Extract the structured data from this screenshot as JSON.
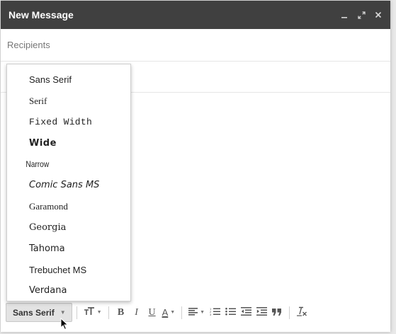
{
  "window": {
    "title": "New Message",
    "controls": {
      "minimize": "_",
      "popout": "⤢",
      "close": "×"
    }
  },
  "recipients": {
    "placeholder": "Recipients"
  },
  "font_menu": {
    "items": [
      {
        "label": "Sans Serif"
      },
      {
        "label": "Serif"
      },
      {
        "label": "Fixed Width"
      },
      {
        "label": "Wide"
      },
      {
        "label": "Narrow"
      },
      {
        "label": "Comic Sans MS"
      },
      {
        "label": "Garamond"
      },
      {
        "label": "Georgia"
      },
      {
        "label": "Tahoma"
      },
      {
        "label": "Trebuchet MS"
      },
      {
        "label": "Verdana"
      }
    ]
  },
  "toolbar": {
    "font_select_label": "Sans Serif",
    "size_icon": "тT",
    "bold": "B",
    "italic": "I",
    "underline": "U",
    "text_color": "A",
    "align_icon": "≡",
    "numbered_list_icon": "⋮≡",
    "bulleted_list_icon": "∷≡",
    "indent_less_icon": "⇤≡",
    "indent_more_icon": "⇥≡",
    "quote_icon": "❞",
    "remove_formatting": "Tx"
  },
  "icons": {
    "minimize": "minimize-icon",
    "popout": "popout-icon",
    "close": "close-icon",
    "cursor": "mouse-pointer-icon"
  }
}
